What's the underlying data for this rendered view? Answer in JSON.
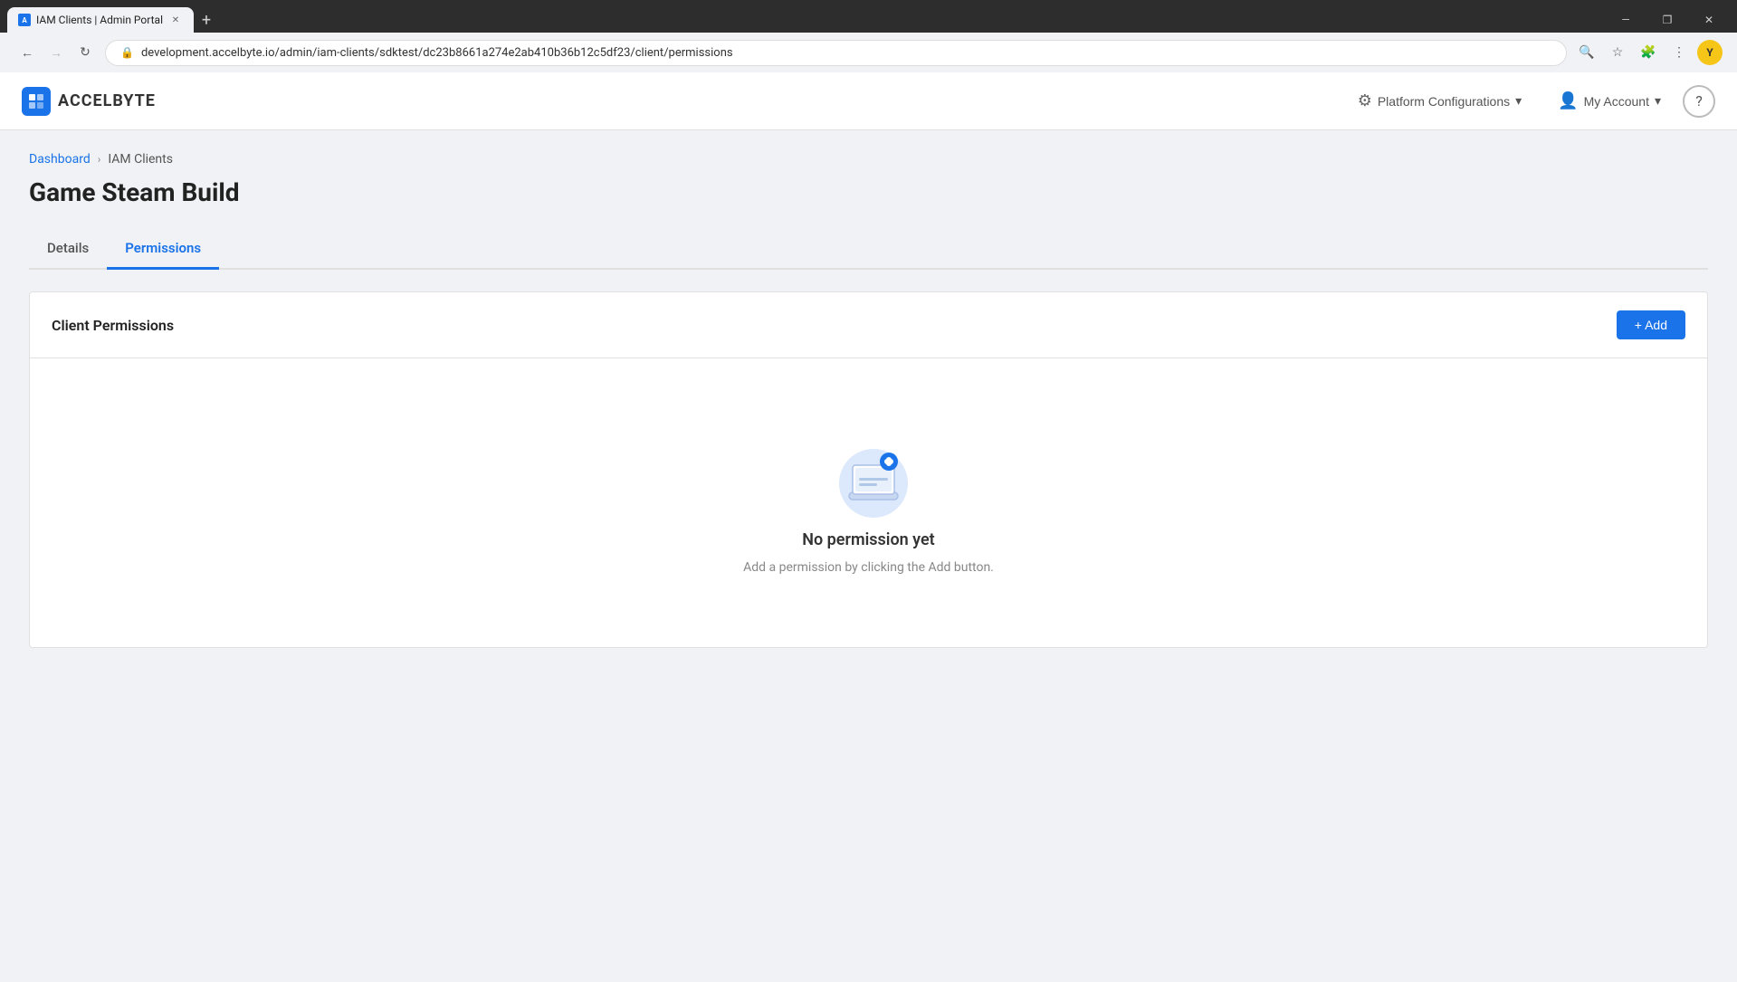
{
  "browser": {
    "tab_title": "IAM Clients | Admin Portal",
    "url": "development.accelbyte.io/admin/iam-clients/sdktest/dc23b8661a274e2ab410b36b12c5df23/client/permissions",
    "nav": {
      "back_disabled": false,
      "forward_disabled": true
    }
  },
  "header": {
    "logo_text": "ACCELBYTE",
    "platform_config_label": "Platform Configurations",
    "my_account_label": "My Account"
  },
  "breadcrumb": {
    "dashboard": "Dashboard",
    "separator": "›",
    "iam_clients": "IAM Clients"
  },
  "page": {
    "title": "Game Steam Build",
    "tabs": [
      {
        "id": "details",
        "label": "Details",
        "active": false
      },
      {
        "id": "permissions",
        "label": "Permissions",
        "active": true
      }
    ]
  },
  "card": {
    "title": "Client Permissions",
    "add_button": "+ Add"
  },
  "empty_state": {
    "title": "No permission yet",
    "subtitle": "Add a permission by clicking the Add button."
  }
}
